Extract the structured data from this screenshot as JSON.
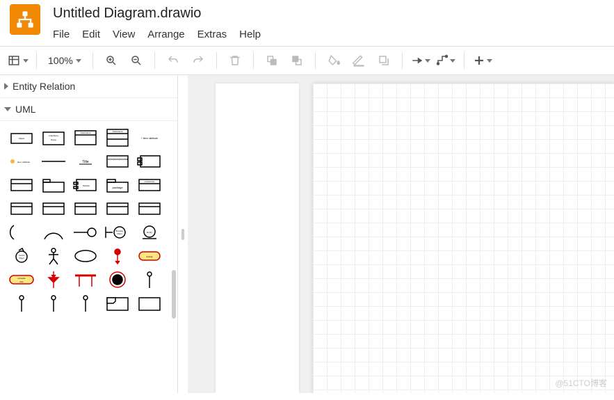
{
  "header": {
    "title": "Untitled Diagram.drawio",
    "menu": [
      "File",
      "Edit",
      "View",
      "Arrange",
      "Extras",
      "Help"
    ]
  },
  "toolbar": {
    "zoom": "100%"
  },
  "sidebar": {
    "sections": [
      {
        "label": "Entity Relation",
        "open": false
      },
      {
        "label": "UML",
        "open": true
      }
    ],
    "shapes": [
      "uml-object",
      "uml-interface",
      "uml-class-simple",
      "uml-class-full",
      "uml-item-attribute",
      "uml-item-attr2",
      "uml-line",
      "uml-title",
      "uml-note",
      "uml-component",
      "uml-box1",
      "uml-tabbed",
      "uml-module",
      "uml-package",
      "uml-component2",
      "uml-box2",
      "uml-box3",
      "uml-box4",
      "uml-box5",
      "uml-box6",
      "uml-usecase-half",
      "uml-usecase-arc",
      "uml-provided",
      "uml-boundary",
      "uml-entity",
      "uml-control",
      "uml-actor",
      "uml-ellipse",
      "uml-start",
      "uml-activity",
      "uml-label",
      "uml-fork-down",
      "uml-fork",
      "uml-end",
      "uml-pin",
      "uml-pin2",
      "uml-pin3",
      "uml-pin4",
      "uml-frame",
      "uml-frame2"
    ]
  },
  "watermark": "@51CTO博客"
}
